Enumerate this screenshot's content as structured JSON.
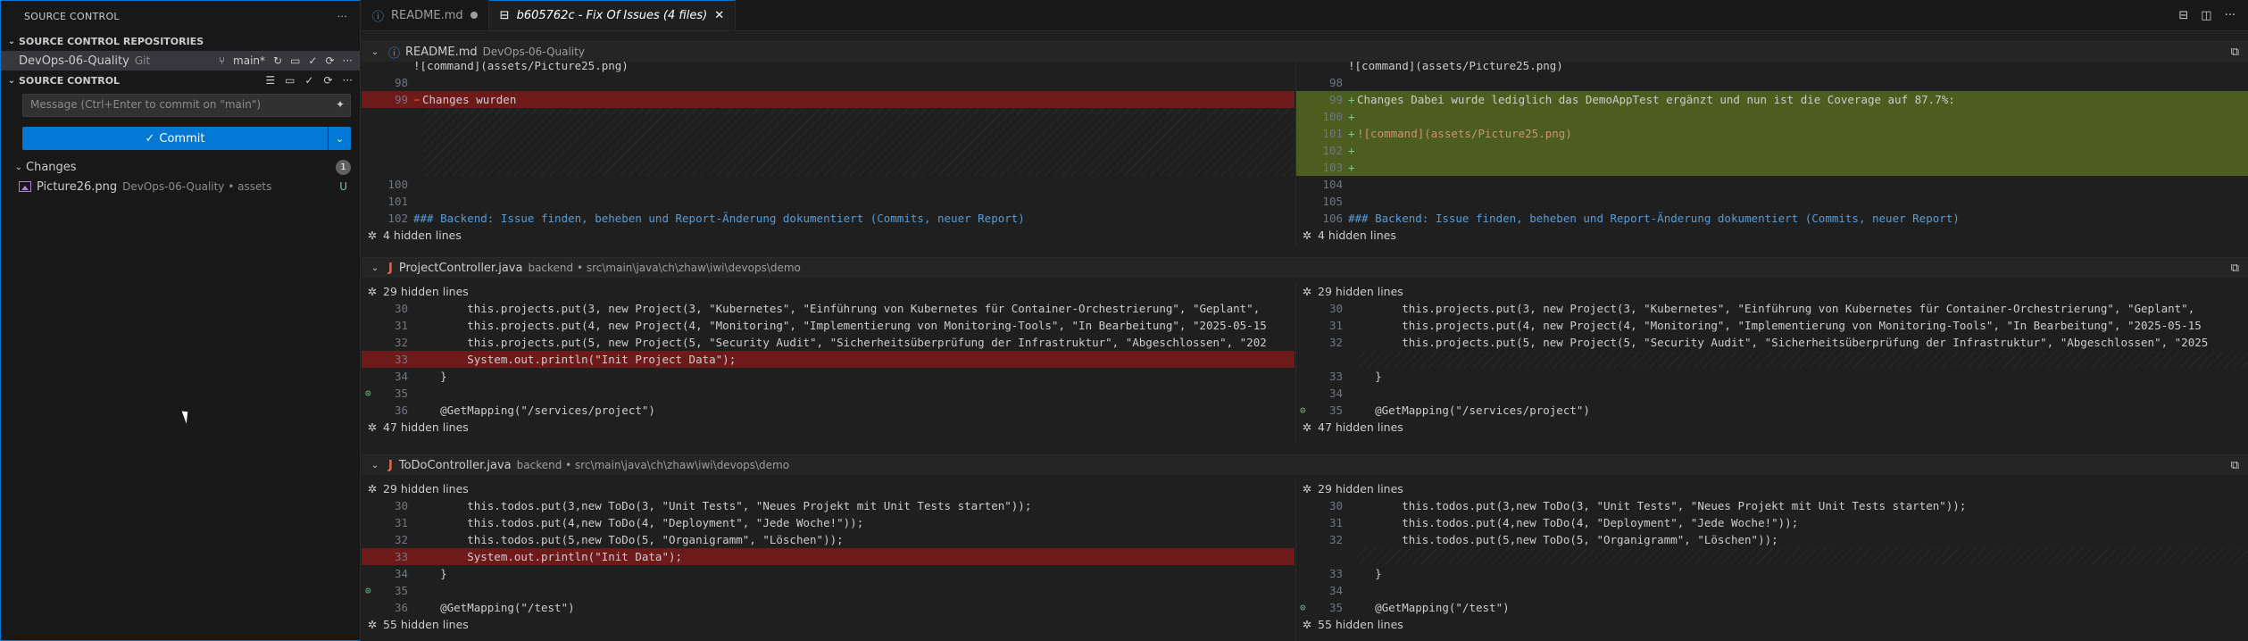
{
  "sidebar": {
    "title": "SOURCE CONTROL",
    "more_icon": "ellipsis-icon",
    "repos_header": "SOURCE CONTROL REPOSITORIES",
    "repo": {
      "name": "DevOps-06-Quality",
      "provider": "Git",
      "branch": "main*"
    },
    "sc_header": "SOURCE CONTROL",
    "message_placeholder": "Message (Ctrl+Enter to commit on \"main\")",
    "commit_label": "Commit",
    "changes_label": "Changes",
    "changes_count": "1",
    "file": {
      "name": "Picture26.png",
      "detail": "DevOps-06-Quality • assets",
      "status": "U"
    }
  },
  "tabs": [
    {
      "label": "README.md",
      "active": false
    },
    {
      "label": "b605762c - Fix Of Issues (4 files)",
      "active": true
    }
  ],
  "files": [
    {
      "name": "README.md",
      "path": "DevOps-06-Quality"
    },
    {
      "name": "ProjectController.java",
      "path": "backend • src\\main\\java\\ch\\zhaw\\iwi\\devops\\demo"
    },
    {
      "name": "ToDoController.java",
      "path": "backend • src\\main\\java\\ch\\zhaw\\iwi\\devops\\demo"
    }
  ],
  "readme": {
    "left": {
      "top_partial": "![command](assets/Picture25.png)",
      "l98": "98",
      "l99": "99",
      "l99_text": "Changes wurden",
      "l100": "100",
      "l101": "101",
      "l102": "102",
      "l102_text": "### Backend: Issue finden, beheben und Report-Änderung dokumentiert (Commits, neuer Report)",
      "hidden": "4 hidden lines"
    },
    "right": {
      "top_partial": "![command](assets/Picture25.png)",
      "l98": "98",
      "l99": "99",
      "l99_text": "Changes Dabei wurde lediglich das DemoAppTest ergänzt und nun ist die Coverage auf 87.7%:",
      "l100": "100",
      "l101": "101",
      "l101_text": "![command](assets/Picture25.png)",
      "l102": "102",
      "l103": "103",
      "l104": "104",
      "l105": "105",
      "l106": "106",
      "l106_text": "### Backend: Issue finden, beheben und Report-Änderung dokumentiert (Commits, neuer Report)",
      "hidden": "4 hidden lines"
    }
  },
  "project": {
    "hidden_top": "29 hidden lines",
    "hidden_bottom": "47 hidden lines",
    "lines": [
      {
        "n": "30",
        "text": "        this.projects.put(3, new Project(3, \"Kubernetes\", \"Einführung von Kubernetes für Container-Orchestrierung\", \"Geplant\","
      },
      {
        "n": "31",
        "text": "        this.projects.put(4, new Project(4, \"Monitoring\", \"Implementierung von Monitoring-Tools\", \"In Bearbeitung\", \"2025-05-15"
      },
      {
        "n": "32",
        "text": "        this.projects.put(5, new Project(5, \"Security Audit\", \"Sicherheitsüberprüfung der Infrastruktur\", \"Abgeschlossen\", \"202"
      },
      {
        "n": "33",
        "text": "        System.out.println(\"Init Project Data\");"
      },
      {
        "n": "34",
        "text": "    }"
      },
      {
        "n": "35",
        "text": ""
      },
      {
        "n": "36",
        "text": "    @GetMapping(\"/services/project\")"
      }
    ],
    "right_lines": [
      {
        "n": "30",
        "text": "        this.projects.put(3, new Project(3, \"Kubernetes\", \"Einführung von Kubernetes für Container-Orchestrierung\", \"Geplant\","
      },
      {
        "n": "31",
        "text": "        this.projects.put(4, new Project(4, \"Monitoring\", \"Implementierung von Monitoring-Tools\", \"In Bearbeitung\", \"2025-05-15"
      },
      {
        "n": "32",
        "text": "        this.projects.put(5, new Project(5, \"Security Audit\", \"Sicherheitsüberprüfung der Infrastruktur\", \"Abgeschlossen\", \"2025"
      },
      {
        "n": "33",
        "text": "    }"
      },
      {
        "n": "34",
        "text": ""
      },
      {
        "n": "35",
        "text": "    @GetMapping(\"/services/project\")"
      }
    ]
  },
  "todo": {
    "hidden_top": "29 hidden lines",
    "hidden_bottom": "55 hidden lines",
    "lines": [
      {
        "n": "30",
        "text": "        this.todos.put(3,new ToDo(3, \"Unit Tests\", \"Neues Projekt mit Unit Tests starten\"));"
      },
      {
        "n": "31",
        "text": "        this.todos.put(4,new ToDo(4, \"Deployment\", \"Jede Woche!\"));"
      },
      {
        "n": "32",
        "text": "        this.todos.put(5,new ToDo(5, \"Organigramm\", \"Löschen\"));"
      },
      {
        "n": "33",
        "text": "        System.out.println(\"Init Data\");"
      },
      {
        "n": "34",
        "text": "    }"
      },
      {
        "n": "35",
        "text": ""
      },
      {
        "n": "36",
        "text": "    @GetMapping(\"/test\")"
      }
    ],
    "right_lines": [
      {
        "n": "30",
        "text": "        this.todos.put(3,new ToDo(3, \"Unit Tests\", \"Neues Projekt mit Unit Tests starten\"));"
      },
      {
        "n": "31",
        "text": "        this.todos.put(4,new ToDo(4, \"Deployment\", \"Jede Woche!\"));"
      },
      {
        "n": "32",
        "text": "        this.todos.put(5,new ToDo(5, \"Organigramm\", \"Löschen\"));"
      },
      {
        "n": "33",
        "text": "    }"
      },
      {
        "n": "34",
        "text": ""
      },
      {
        "n": "35",
        "text": "    @GetMapping(\"/test\")"
      }
    ]
  },
  "colors": {
    "accent": "#0078d4",
    "deleted": "#6e1a1a",
    "inserted": "#4b5e1f",
    "untracked": "#73c991"
  }
}
